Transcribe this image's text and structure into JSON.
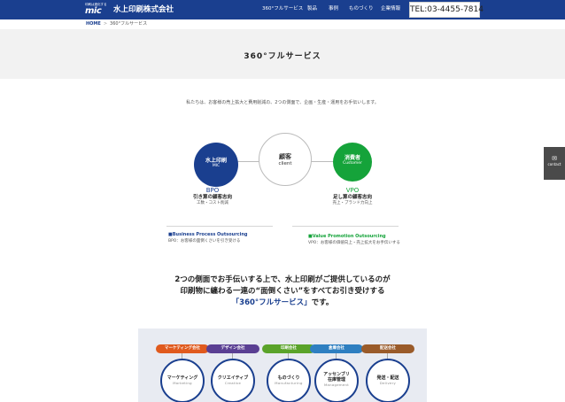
{
  "header": {
    "logo_tagline": "印刷は進化する",
    "logo_mark": "mic",
    "company_name": "水上印刷株式会社",
    "nav": [
      "360°フルサービス",
      "製品",
      "事例",
      "ものづくり",
      "企業情報"
    ],
    "tel": "TEL:03-4455-7814",
    "colors": {
      "brand": "#1a3f8f",
      "accent_green": "#15a33a"
    }
  },
  "breadcrumb": {
    "home": "HOME",
    "separator": ">",
    "current": "360°フルサービス"
  },
  "page": {
    "title": "360°フルサービス",
    "intro": "私たちは、お客様の売上拡大と費用削減の、2つの側面で、企画・生産・運用をお手伝いします。"
  },
  "diagram": {
    "left": {
      "title": "水上印刷",
      "subtitle": "MIC"
    },
    "center": {
      "title": "顧客",
      "subtitle": "client"
    },
    "right": {
      "title": "消費者",
      "subtitle": "Customer"
    },
    "bpo": {
      "abbr": "BPO",
      "heading": "引き算の顧客志向",
      "note": "工数・コスト削減"
    },
    "vpo": {
      "abbr": "VPO",
      "heading": "足し算の顧客志向",
      "note": "売上・ブランド力向上"
    }
  },
  "definitions": {
    "bpo": {
      "term": "■Business Process Outsourcing",
      "desc": "BPO：お客様の面倒くさいを引き受ける"
    },
    "vpo": {
      "term": "■Value Promotion Outsourcing",
      "desc": "VPO：お客様の価値向上・売上拡大をお手伝いする"
    }
  },
  "lead": {
    "line1": "2つの側面でお手伝いする上で、水上印刷がご提供しているのが",
    "line2": "印刷物に纏わる一連の“面倒くさい”をすべてお引き受けする",
    "line3_highlight": "「360°フルサービス」",
    "line3_rest": "です。"
  },
  "services": [
    {
      "company": "マーケティング会社",
      "label": "マーケティング",
      "label2": "",
      "en": "Marketing",
      "color": "#e05a1e"
    },
    {
      "company": "デザイン会社",
      "label": "クリエイティブ",
      "label2": "",
      "en": "Creative",
      "color": "#5a3f93"
    },
    {
      "company": "印刷会社",
      "label": "ものづくり",
      "label2": "",
      "en": "Manufacturing",
      "color": "#5aa32a"
    },
    {
      "company": "倉庫会社",
      "label": "アッセンブリ",
      "label2": "在庫管理",
      "en": "Management",
      "color": "#2e7fc1"
    },
    {
      "company": "配送会社",
      "label": "発送・配送",
      "label2": "",
      "en": "Delivery",
      "color": "#9a5b2a"
    }
  ],
  "side_tab": {
    "icon": "mail-icon",
    "label": "contact"
  }
}
